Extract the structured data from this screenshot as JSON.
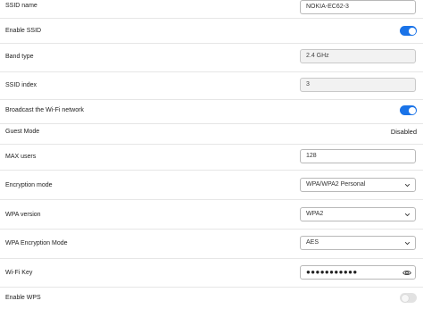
{
  "form": {
    "ssid_name": {
      "label": "SSID name",
      "value": "NOKIA-EC62-3"
    },
    "enable_ssid": {
      "label": "Enable SSID",
      "state": "on"
    },
    "band_type": {
      "label": "Band type",
      "value": "2.4 GHz"
    },
    "ssid_index": {
      "label": "SSID index",
      "value": "3"
    },
    "broadcast": {
      "label": "Broadcast the Wi-Fi network",
      "state": "on"
    },
    "guest_mode": {
      "label": "Guest Mode",
      "value": "Disabled"
    },
    "max_users": {
      "label": "MAX users",
      "value": "128"
    },
    "encryption_mode": {
      "label": "Encryption mode",
      "value": "WPA/WPA2 Personal"
    },
    "wpa_version": {
      "label": "WPA version",
      "value": "WPA2"
    },
    "wpa_encryption_mode": {
      "label": "WPA Encryption Mode",
      "value": "AES"
    },
    "wifi_key": {
      "label": "Wi-Fi Key",
      "value": "●●●●●●●●●●●"
    },
    "enable_wps": {
      "label": "Enable WPS",
      "state": "off"
    }
  },
  "colors": {
    "accent": "#1a73e8",
    "toggle_off": "#e2e2e2",
    "divider": "#e6e6e6",
    "readonly_bg": "#f2f2f2"
  },
  "icons": {
    "select_arrow": "chevron-down-icon",
    "show_password": "eye-icon"
  }
}
